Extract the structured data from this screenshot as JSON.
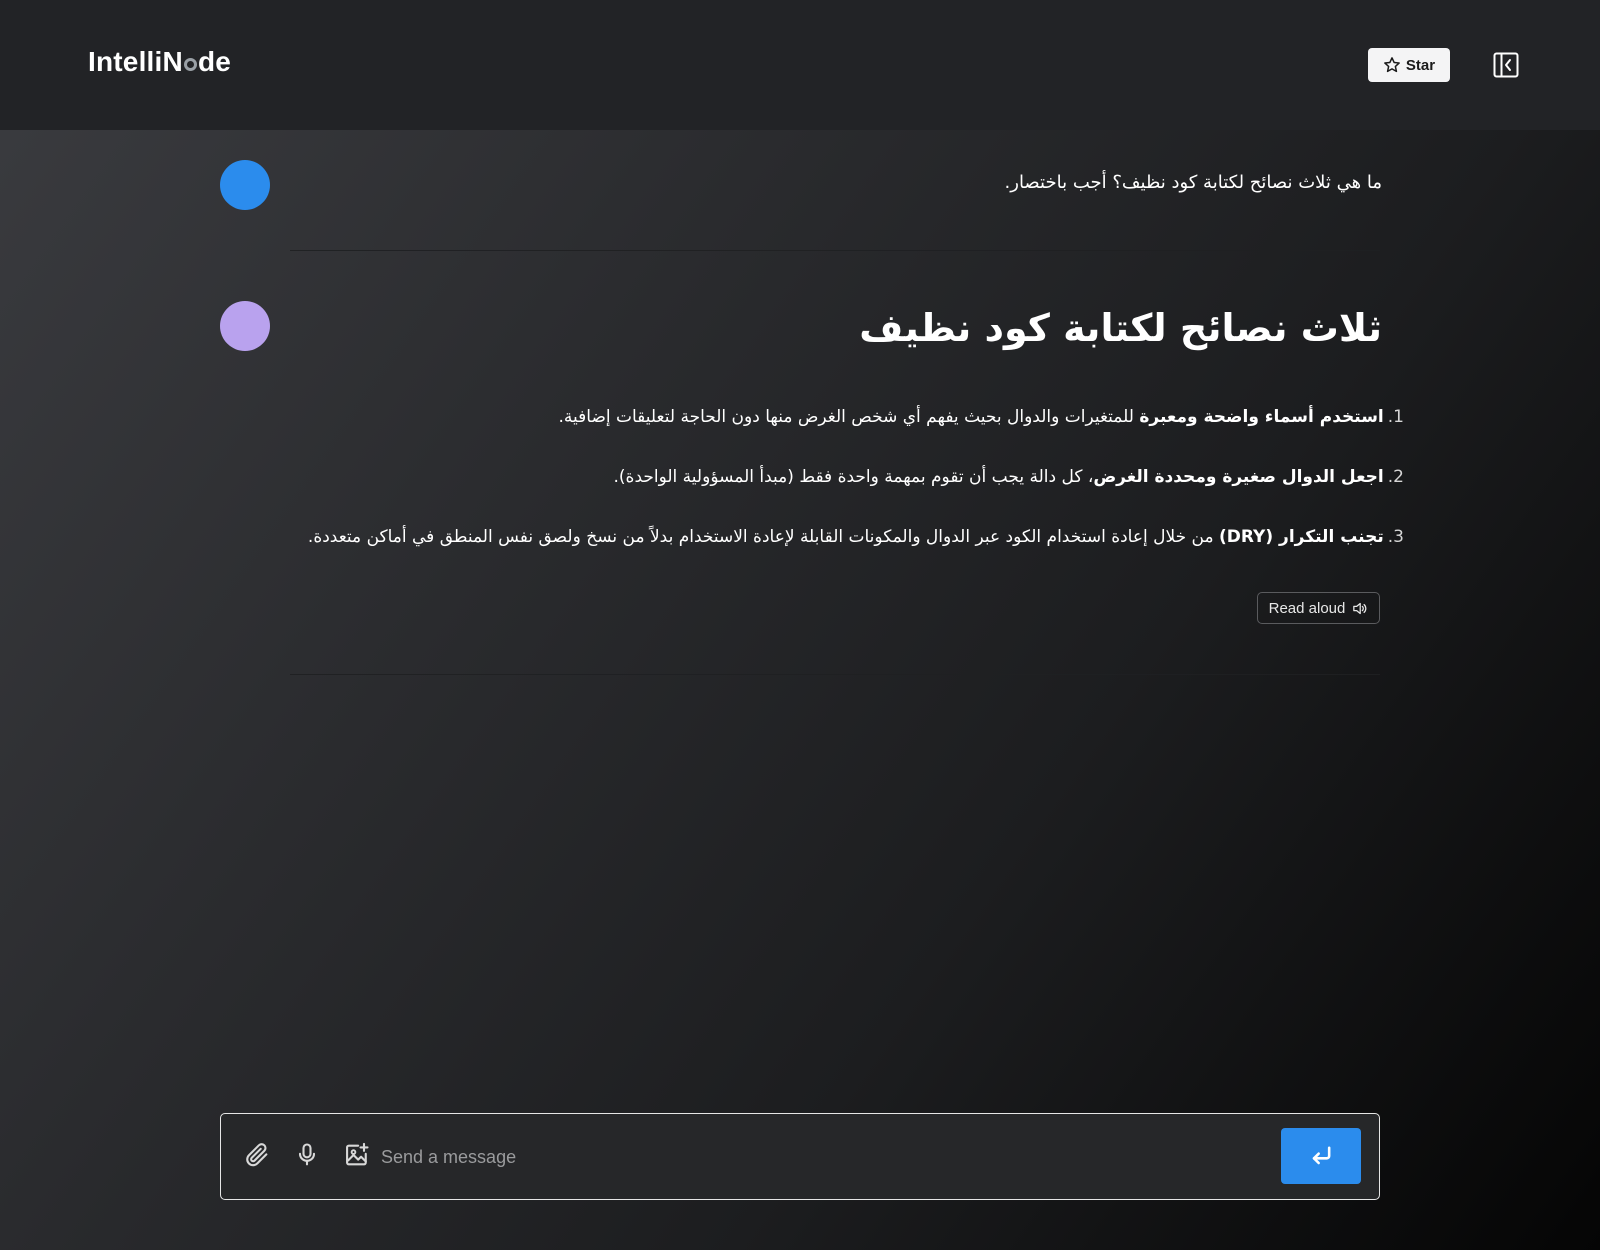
{
  "header": {
    "brand_prefix": "IntelliN",
    "brand_suffix": "de",
    "star_label": "Star",
    "star_icon": "star-icon",
    "sidebar_toggle_icon": "sidebar-collapse-icon"
  },
  "chat": {
    "user_message": "ما هي ثلاث نصائح لكتابة كود نظيف؟ أجب باختصار.",
    "answer_title": "ثلاث نصائح لكتابة كود نظيف",
    "tips": [
      {
        "num": "1.",
        "bold": "استخدم أسماء واضحة ومعبرة",
        "rest": " للمتغيرات والدوال بحيث يفهم أي شخص الغرض منها دون الحاجة لتعليقات إضافية."
      },
      {
        "num": "2.",
        "bold": "اجعل الدوال صغيرة ومحددة الغرض",
        "rest": "، كل دالة يجب أن تقوم بمهمة واحدة فقط (مبدأ المسؤولية الواحدة)."
      },
      {
        "num": "3.",
        "bold": "تجنب التكرار (DRY)",
        "rest": " من خلال إعادة استخدام الكود عبر الدوال والمكونات القابلة لإعادة الاستخدام بدلاً من نسخ ولصق نفس المنطق في أماكن متعددة."
      }
    ],
    "read_aloud_label": "Read aloud",
    "read_aloud_icon": "speaker-icon"
  },
  "composer": {
    "placeholder": "Send a message",
    "value": "",
    "attach_icon": "paperclip-icon",
    "mic_icon": "microphone-icon",
    "image_icon": "image-add-icon",
    "send_icon": "enter-arrow-icon"
  },
  "colors": {
    "accent": "#2b8ced",
    "assistant_avatar": "#b9a2ee",
    "header_bg": "#222326"
  }
}
